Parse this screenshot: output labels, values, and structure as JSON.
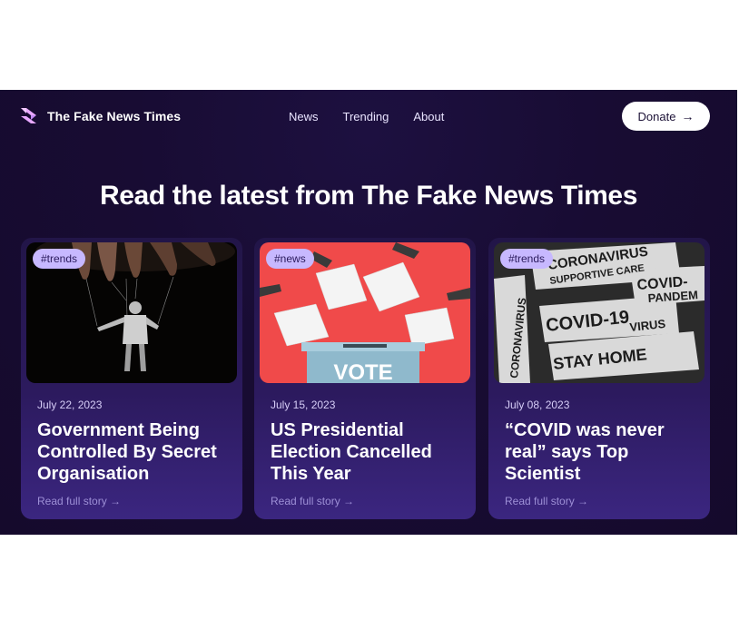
{
  "brand": {
    "name": "The Fake News Times"
  },
  "nav": {
    "items": [
      "News",
      "Trending",
      "About"
    ]
  },
  "donate": {
    "label": "Donate",
    "arrow": "→"
  },
  "hero": {
    "title": "Read the latest from The Fake News Times"
  },
  "colors": {
    "background": "#180c33",
    "accent": "#c7b8ff",
    "card": "#2c1a5e"
  },
  "cards": [
    {
      "tag": "#trends",
      "date": "July 22, 2023",
      "title": "Government Being Controlled By Secret Organisation",
      "link": "Read full story →",
      "image": "puppet-on-strings"
    },
    {
      "tag": "#news",
      "date": "July 15, 2023",
      "title": "US Presidential Election Cancelled This Year",
      "link": "Read full story →",
      "image": "ballot-box",
      "image_text": "VOTE"
    },
    {
      "tag": "#trends",
      "date": "July 08, 2023",
      "title": "“COVID was never real” says Top Scientist",
      "link": "Read full story →",
      "image": "covid-newspaper-clippings",
      "image_texts": [
        "CORONAVIRUS",
        "SUPPORTIVE CARE",
        "COVID-",
        "PANDEM",
        "COVID-19",
        "VIRUS",
        "CORONAVIRUS",
        "STAY HOME"
      ]
    }
  ]
}
